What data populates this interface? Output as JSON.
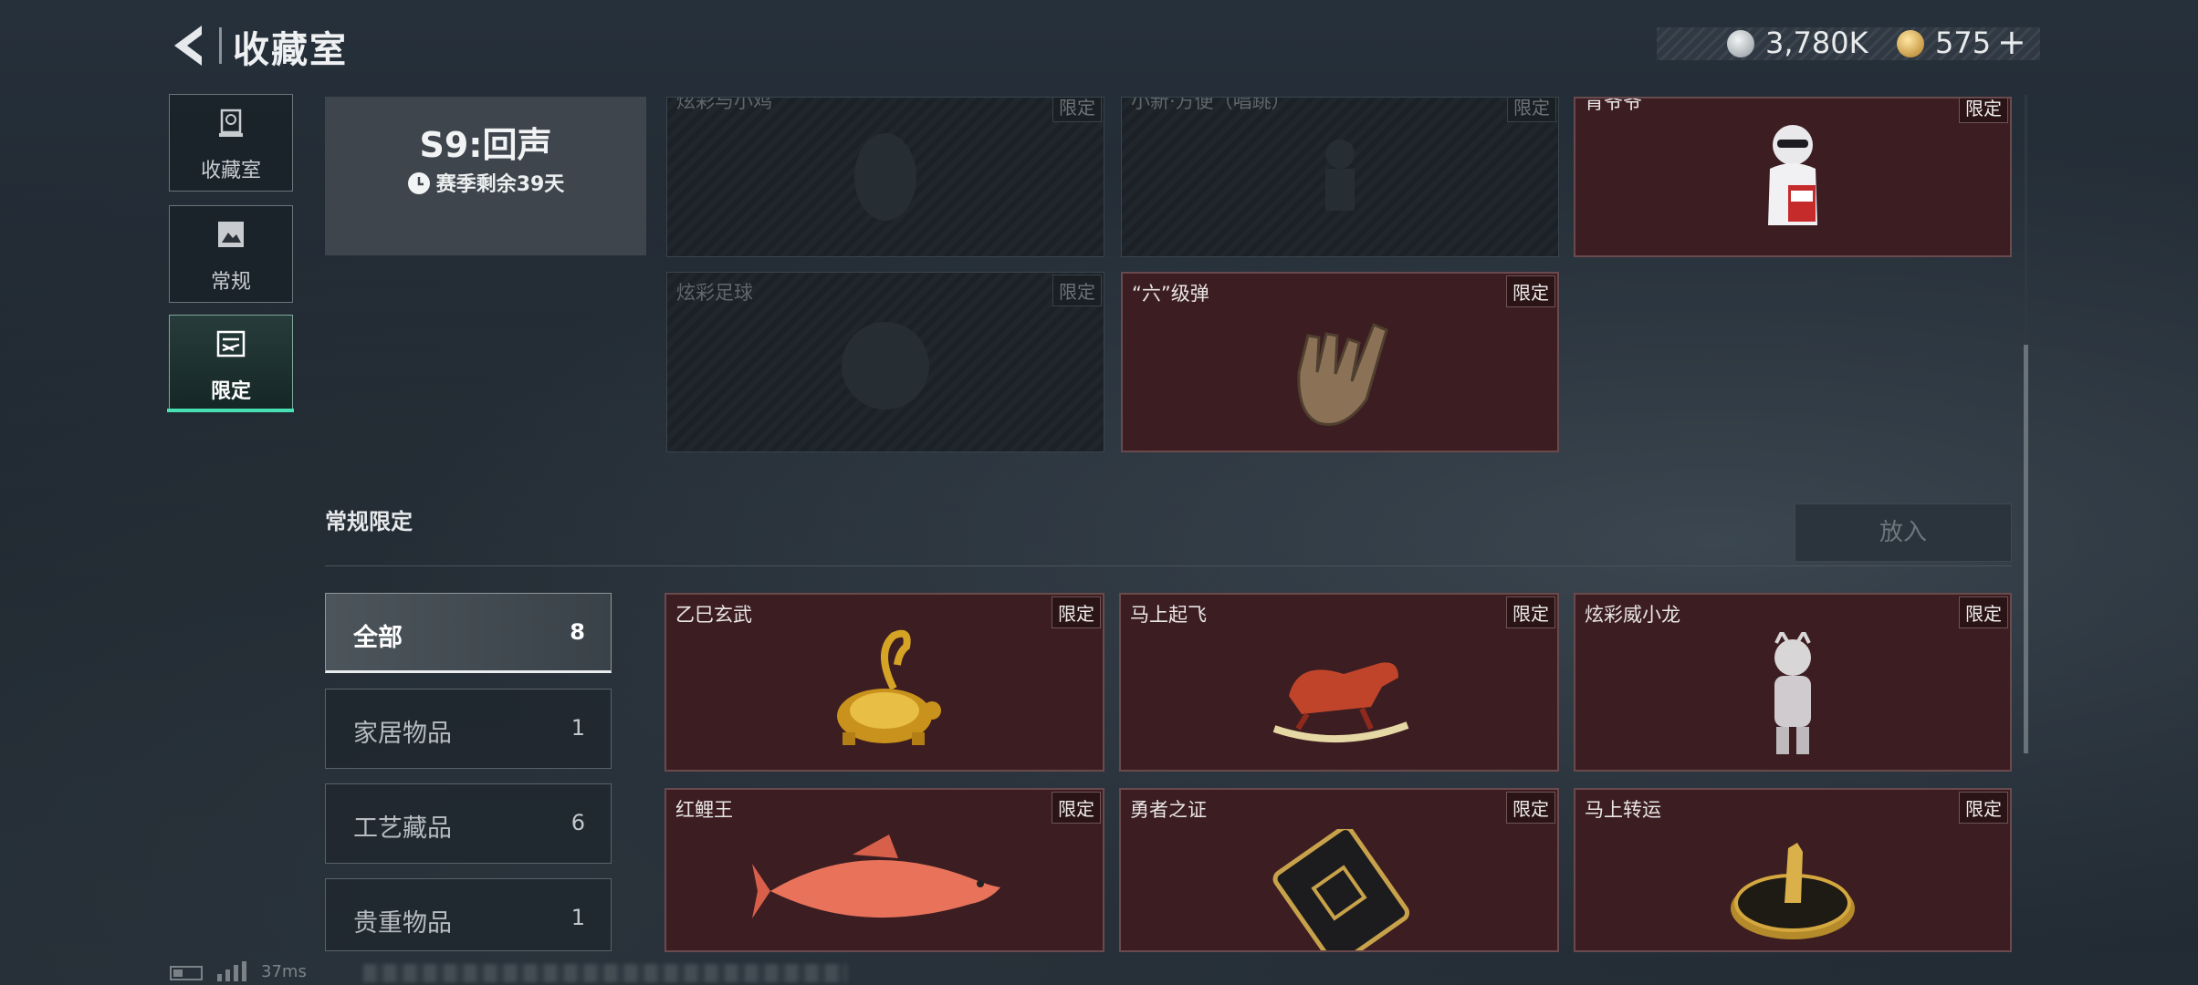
{
  "header": {
    "title": "收藏室",
    "currency": [
      {
        "icon": "silver-coin-icon",
        "value": "3,780K"
      },
      {
        "icon": "gold-coin-icon",
        "value": "575",
        "add": "+"
      }
    ]
  },
  "nav": [
    {
      "label": "收藏室",
      "icon": "trophy-icon",
      "active": false
    },
    {
      "label": "常规",
      "icon": "picture-icon",
      "active": false
    },
    {
      "label": "限定",
      "icon": "limited-icon",
      "active": true
    }
  ],
  "season": {
    "name": "S9:回声",
    "remaining": "赛季剩余39天"
  },
  "top_items": [
    {
      "name": "炫彩与小鸡",
      "tag": "限定",
      "locked": true
    },
    {
      "name": "小新·方便（唱跳）",
      "tag": "限定",
      "locked": true
    },
    {
      "name": "肯爷爷",
      "tag": "限定",
      "locked": false
    },
    {
      "name": "炫彩足球",
      "tag": "限定",
      "locked": true
    },
    {
      "name": "“六”级弹",
      "tag": "限定",
      "locked": false
    }
  ],
  "section": {
    "title": "常规限定",
    "put_button": "放入"
  },
  "filters": [
    {
      "label": "全部",
      "count": "8",
      "active": true
    },
    {
      "label": "家居物品",
      "count": "1",
      "active": false
    },
    {
      "label": "工艺藏品",
      "count": "6",
      "active": false
    },
    {
      "label": "贵重物品",
      "count": "1",
      "active": false
    }
  ],
  "items": [
    {
      "name": "乙巳玄武",
      "tag": "限定"
    },
    {
      "name": "马上起飞",
      "tag": "限定"
    },
    {
      "name": "炫彩威小龙",
      "tag": "限定"
    },
    {
      "name": "红鲤王",
      "tag": "限定"
    },
    {
      "name": "勇者之证",
      "tag": "限定"
    },
    {
      "name": "马上转运",
      "tag": "限定"
    }
  ],
  "status": {
    "network": "37ms"
  },
  "colors": {
    "accent": "#46e0b4",
    "card_bg": "#3c1d22",
    "card_border": "#6a4a4d"
  }
}
